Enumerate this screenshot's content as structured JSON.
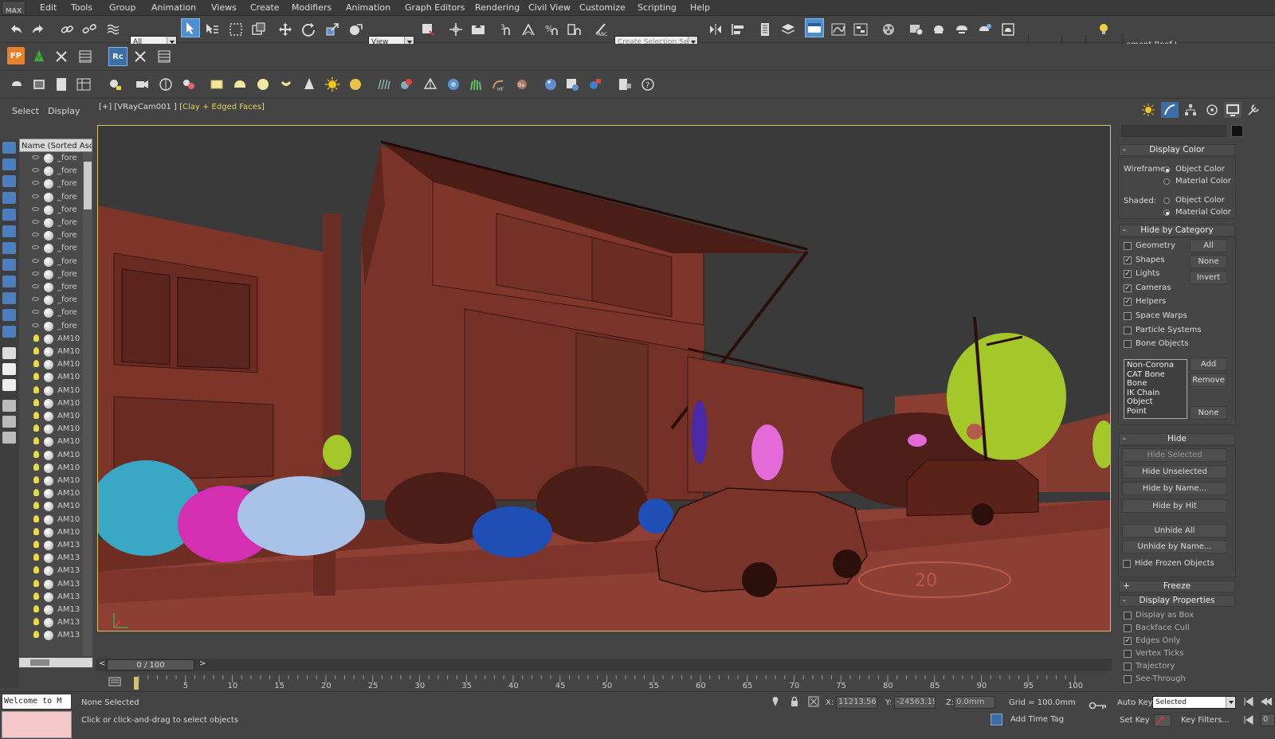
{
  "app": {
    "logo": "MAX"
  },
  "menu": [
    "Edit",
    "Tools",
    "Group",
    "Animation",
    "Views",
    "Create",
    "Modifiers",
    "Animation",
    "Graph Editors",
    "Rendering",
    "Civil View",
    "Customize",
    "Scripting",
    "Help"
  ],
  "toolbar": {
    "filter_value": "All",
    "view_value": "View",
    "selection_set_value": "Create Selection Se",
    "workspace_label": "ement Roof Su"
  },
  "left_panel": {
    "tab_select": "Select",
    "tab_display": "Display",
    "list_header": "Name (Sorted Ascen",
    "items": [
      "_fore",
      "_fore",
      "_fore",
      "_fore",
      "_fore",
      "_fore",
      "_fore",
      "_fore",
      "_fore",
      "_fore",
      "_fore",
      "_fore",
      "_fore",
      "_fore",
      "AM10",
      "AM10",
      "AM10",
      "AM10",
      "AM10",
      "AM10",
      "AM10",
      "AM10",
      "AM10",
      "AM10",
      "AM10",
      "AM10",
      "AM10",
      "AM10",
      "AM10",
      "AM10",
      "AM13",
      "AM13",
      "AM13",
      "AM13",
      "AM13",
      "AM13",
      "AM13",
      "AM13"
    ],
    "light_items_start": 14
  },
  "viewport": {
    "label_prefix": "[+] [VRayCam001 ] [",
    "label_mode": "Clay + Edged Faces",
    "label_suffix": "]",
    "mode_color": "#e8d44a",
    "clay_color": "#8e3f33",
    "road_marking": "20"
  },
  "time_slider": {
    "value": "0 / 100",
    "prev": "<",
    "next": ">"
  },
  "track_ticks": [
    "5",
    "10",
    "15",
    "20",
    "25",
    "30",
    "35",
    "40",
    "45",
    "50",
    "55",
    "60",
    "65",
    "70",
    "75",
    "80",
    "85",
    "90",
    "95",
    "100"
  ],
  "status": {
    "welcome": "Welcome to M",
    "selection": "None Selected",
    "prompt": "Click or click-and-drag to select objects",
    "x_label": "X:",
    "x_value": "11213.563",
    "y_label": "Y:",
    "y_value": "-24563.19",
    "z_label": "Z:",
    "z_value": "0.0mm",
    "grid": "Grid = 100.0mm",
    "add_time_tag": "Add Time Tag",
    "auto_key": "Auto Key",
    "key_mode": "Selected",
    "set_key": "Set Key",
    "key_filters": "Key Filters...",
    "frame_field": "0"
  },
  "right_panel": {
    "display_color": {
      "title": "Display Color",
      "wireframe_label": "Wireframe:",
      "shaded_label": "Shaded:",
      "object_color": "Object Color",
      "material_color": "Material Color",
      "wireframe_selected": "object",
      "shaded_selected": "material"
    },
    "hide_by_category": {
      "title": "Hide by Category",
      "items": [
        {
          "label": "Geometry",
          "checked": false
        },
        {
          "label": "Shapes",
          "checked": true
        },
        {
          "label": "Lights",
          "checked": true
        },
        {
          "label": "Cameras",
          "checked": true
        },
        {
          "label": "Helpers",
          "checked": true
        },
        {
          "label": "Space Warps",
          "checked": false
        },
        {
          "label": "Particle Systems",
          "checked": false
        },
        {
          "label": "Bone Objects",
          "checked": false
        }
      ],
      "btn_all": "All",
      "btn_none": "None",
      "btn_invert": "Invert",
      "list": [
        "Non-Corona",
        "CAT Bone",
        "Bone",
        "IK Chain Object",
        "Point"
      ],
      "btn_add": "Add",
      "btn_remove": "Remove",
      "btn_none2": "None"
    },
    "hide": {
      "title": "Hide",
      "buttons": [
        "Hide Selected",
        "Hide Unselected",
        "Hide by Name...",
        "Hide by Hit",
        "Unhide All",
        "Unhide by Name..."
      ],
      "hide_frozen": "Hide Frozen Objects"
    },
    "freeze": {
      "title": "Freeze"
    },
    "display_properties": {
      "title": "Display Properties",
      "items": [
        {
          "label": "Display as Box",
          "checked": false
        },
        {
          "label": "Backface Cull",
          "checked": false
        },
        {
          "label": "Edges Only",
          "checked": true
        },
        {
          "label": "Vertex Ticks",
          "checked": false
        },
        {
          "label": "Trajectory",
          "checked": false
        },
        {
          "label": "See-Through",
          "checked": false
        }
      ]
    }
  },
  "colors": {
    "accent": "#4f8fd0",
    "viewport_border": "#d6c26a",
    "sky": "#3a3a3a",
    "foliage_cyan": "#3aa7c4",
    "foliage_magenta": "#d42fb0",
    "foliage_lightblue": "#a9c3e8",
    "foliage_blue": "#1f4fb5",
    "foliage_yellowgreen": "#a4c72a",
    "foliage_pink": "#e46ad8",
    "foliage_purple": "#4a2aa8"
  }
}
